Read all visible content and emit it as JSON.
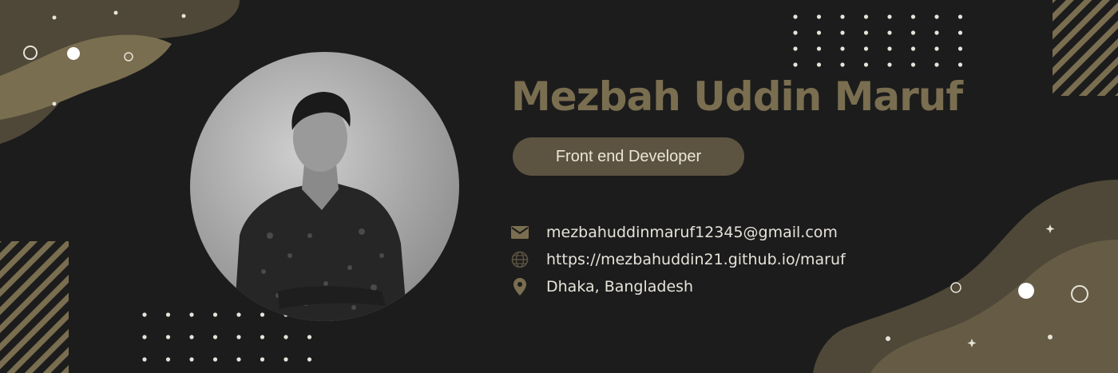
{
  "profile": {
    "name": "Mezbah Uddin Maruf",
    "role": "Front end Developer",
    "photo_alt": "grayscale-portrait"
  },
  "contacts": [
    {
      "icon": "mail-icon",
      "text": "mezbahuddinmaruf12345@gmail.com"
    },
    {
      "icon": "globe-icon",
      "text": "https://mezbahuddin21.github.io/maruf"
    },
    {
      "icon": "location-pin-icon",
      "text": "Dhaka, Bangladesh"
    }
  ],
  "colors": {
    "background": "#1c1c1c",
    "accent": "#7a6e50",
    "accent_dark": "#5c5341",
    "text": "#e6e3da"
  }
}
